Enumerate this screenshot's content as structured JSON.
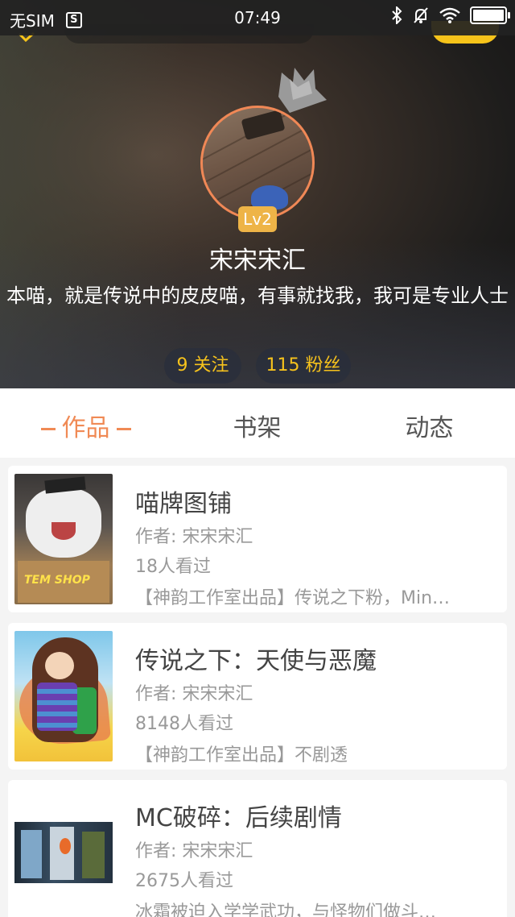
{
  "status_bar": {
    "carrier": "无SIM",
    "sim_icon_letter": "S",
    "time": "07:49"
  },
  "profile": {
    "level": "Lv2",
    "username": "宋宋宋汇",
    "bio": "本喵，就是传说中的皮皮喵，有事就找我，我可是专业人士",
    "following": "9 关注",
    "fans": "115 粉丝"
  },
  "tabs": [
    {
      "label": "作品",
      "active": true
    },
    {
      "label": "书架",
      "active": false
    },
    {
      "label": "动态",
      "active": false
    }
  ],
  "works": [
    {
      "title": "喵牌图铺",
      "author": "作者: 宋宋宋汇",
      "views": "18人看过",
      "description": "【神韵工作室出品】传说之下粉，Min…",
      "cover_text": "TEM SHOP"
    },
    {
      "title": "传说之下：天使与恶魔",
      "author": "作者: 宋宋宋汇",
      "views": "8148人看过",
      "description": "【神韵工作室出品】不剧透"
    },
    {
      "title": "MC破碎：后续剧情",
      "author": "作者: 宋宋宋汇",
      "views": "2675人看过",
      "description": "冰霜被迫入学学武功，与怪物们做斗…"
    }
  ],
  "colors": {
    "accent_orange": "#f08a55",
    "badge_yellow": "#eeb447",
    "pill_text_yellow": "#f6c21c"
  }
}
